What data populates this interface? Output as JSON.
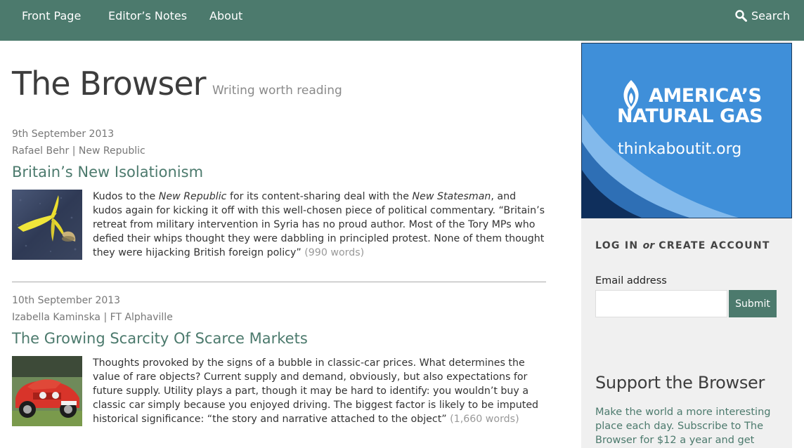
{
  "nav": {
    "items": [
      {
        "label": "Front Page"
      },
      {
        "label": "Editor’s Notes"
      },
      {
        "label": "About"
      }
    ],
    "search_label": "Search"
  },
  "masthead": {
    "title": "The Browser",
    "tagline": "Writing worth reading"
  },
  "articles": [
    {
      "date": "9th September 2013",
      "source": "Rafael Behr | New Republic",
      "title": "Britain’s New Isolationism",
      "intro": "Kudos to the ",
      "em1": "New Republic",
      "mid": " for its content-sharing deal with the ",
      "em2": "New Statesman",
      "rest": ", and kudos again for kicking it off with this well-chosen piece of political commentary. “Britain’s retreat from military intervention in Syria has no proud author. Most of the Tory MPs who defied their whips thought they were dabbling in principled protest. None of them thought they were hijacking British foreign policy”",
      "words": "(990 words)",
      "thumb_icon": "banana-peel-photo"
    },
    {
      "date": "10th September 2013",
      "source": "Izabella Kaminska | FT Alphaville",
      "title": "The Growing Scarcity Of Scarce Markets",
      "text": "Thoughts provoked by the signs of a bubble in classic-car prices. What determines the value of rare objects? Current supply and demand, obviously, but also expectations for future supply. Utility plays a part, though it may be hard to identify: you wouldn’t buy a classic car simply because you enjoyed driving. The biggest factor is likely to be imputed historical significance: “the story and narrative attached to the object”",
      "words": "(1,660 words)",
      "thumb_icon": "red-classic-car-photo"
    }
  ],
  "sidebar": {
    "ad": {
      "title_line1": "AMERICA’S",
      "title_line2": "NATURAL GAS",
      "url": "thinkaboutit.org"
    },
    "login": {
      "heading_pre": "LOG IN ",
      "heading_or": "or",
      "heading_post": " CREATE ACCOUNT",
      "email_label": "Email address",
      "email_value": "",
      "submit_label": "Submit"
    },
    "support": {
      "heading": "Support the Browser",
      "text": "Make the world a more interesting place each day. Subscribe to The Browser for $12 a year and get"
    }
  },
  "colors": {
    "brand": "#4c7a6d",
    "ad_blue": "#3f8fd9"
  }
}
